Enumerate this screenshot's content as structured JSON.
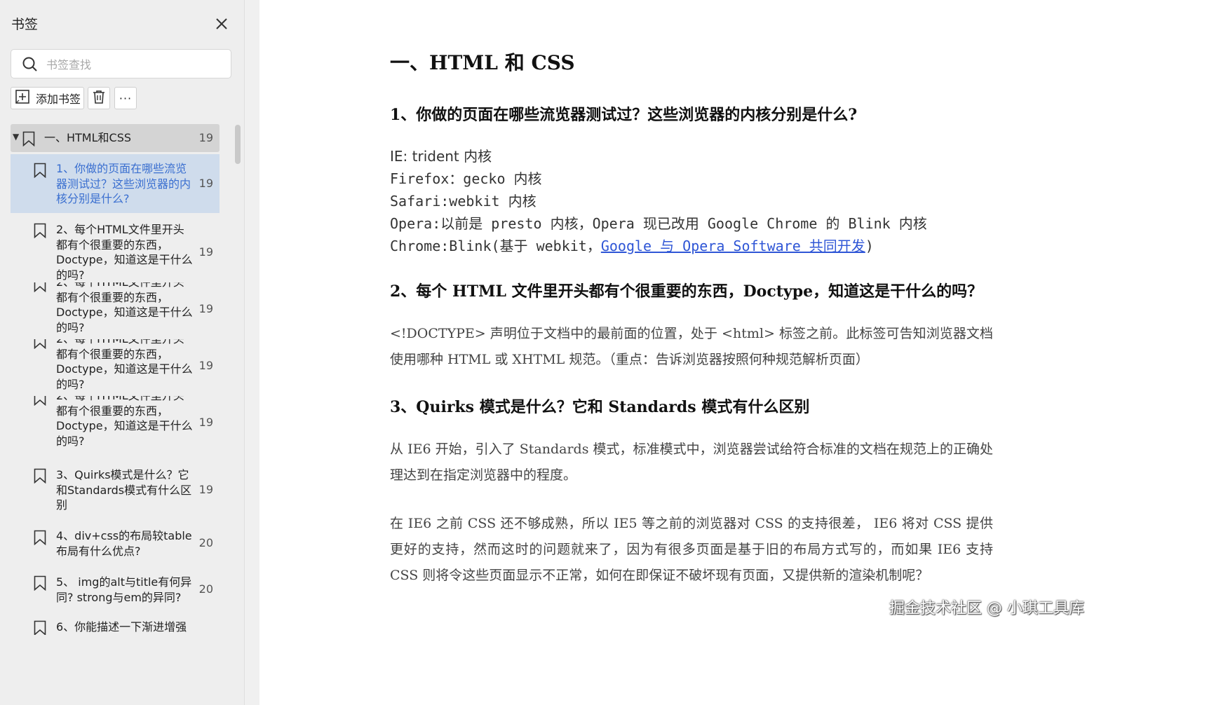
{
  "sidebar": {
    "title": "书签",
    "search_placeholder": "书签查找",
    "add_bookmark_label": "添加书签",
    "more_label": "···",
    "items": [
      {
        "text": "一、HTML和CSS",
        "page": "19"
      },
      {
        "text": "1、你做的页面在哪些流览器测试过？这些浏览器的内核分别是什么?",
        "page": "19"
      },
      {
        "text": "2、每个HTML文件里开头都有个很重要的东西，Doctype，知道这是干什么的吗?",
        "page": "19"
      },
      {
        "text": "2、每个HTML文件里开头都有个很重要的东西，Doctype，知道这是干什么的吗?",
        "page": "19"
      },
      {
        "text": "2、每个HTML文件里开头都有个很重要的东西，Doctype，知道这是干什么的吗?",
        "page": "19"
      },
      {
        "text": "2、每个HTML文件里开头都有个很重要的东西，Doctype，知道这是干什么的吗?",
        "page": "19"
      },
      {
        "text": "3、Quirks模式是什么？它和Standards模式有什么区别",
        "page": "19"
      },
      {
        "text": "4、div+css的布局较table布局有什么优点?",
        "page": "20"
      },
      {
        "text": "5、 img的alt与title有何异同?  strong与em的异同?",
        "page": "20"
      },
      {
        "text": "6、你能描述一下渐进增强",
        "page": ""
      }
    ]
  },
  "document": {
    "h1": "一、HTML 和 CSS",
    "q1": "1、你做的页面在哪些流览器测试过？这些浏览器的内核分别是什么?",
    "engines": {
      "ie": "IE: trident 内核",
      "firefox": "Firefox：gecko 内核",
      "safari": "Safari:webkit 内核",
      "opera": "Opera:以前是 presto 内核，Opera 现已改用 Google Chrome 的 Blink 内核",
      "chrome_prefix": "Chrome:Blink(基于 webkit，",
      "chrome_link": "Google 与 Opera Software 共同开发",
      "chrome_suffix": ")"
    },
    "q2": "2、每个 HTML 文件里开头都有个很重要的东西，Doctype，知道这是干什么的吗？",
    "a2": "<!DOCTYPE>  声明位于文档中的最前面的位置，处于 <html> 标签之前。此标签可告知浏览器文档使用哪种 HTML 或 XHTML 规范。（重点：告诉浏览器按照何种规范解析页面）",
    "q3": "3、Quirks 模式是什么？它和 Standards 模式有什么区别",
    "a3_p1": "从 IE6 开始，引入了 Standards 模式，标准模式中，浏览器尝试给符合标准的文档在规范上的正确处理达到在指定浏览器中的程度。",
    "a3_p2": "在 IE6 之前 CSS 还不够成熟，所以 IE5 等之前的浏览器对 CSS 的支持很差，  IE6 将对 CSS 提供更好的支持，然而这时的问题就来了，因为有很多页面是基于旧的布局方式写的，而如果 IE6  支持 CSS 则将令这些页面显示不正常，如何在即保证不破坏现有页面，又提供新的渲染机制呢？"
  },
  "watermark": "掘金技术社区 @ 小琪工具库"
}
